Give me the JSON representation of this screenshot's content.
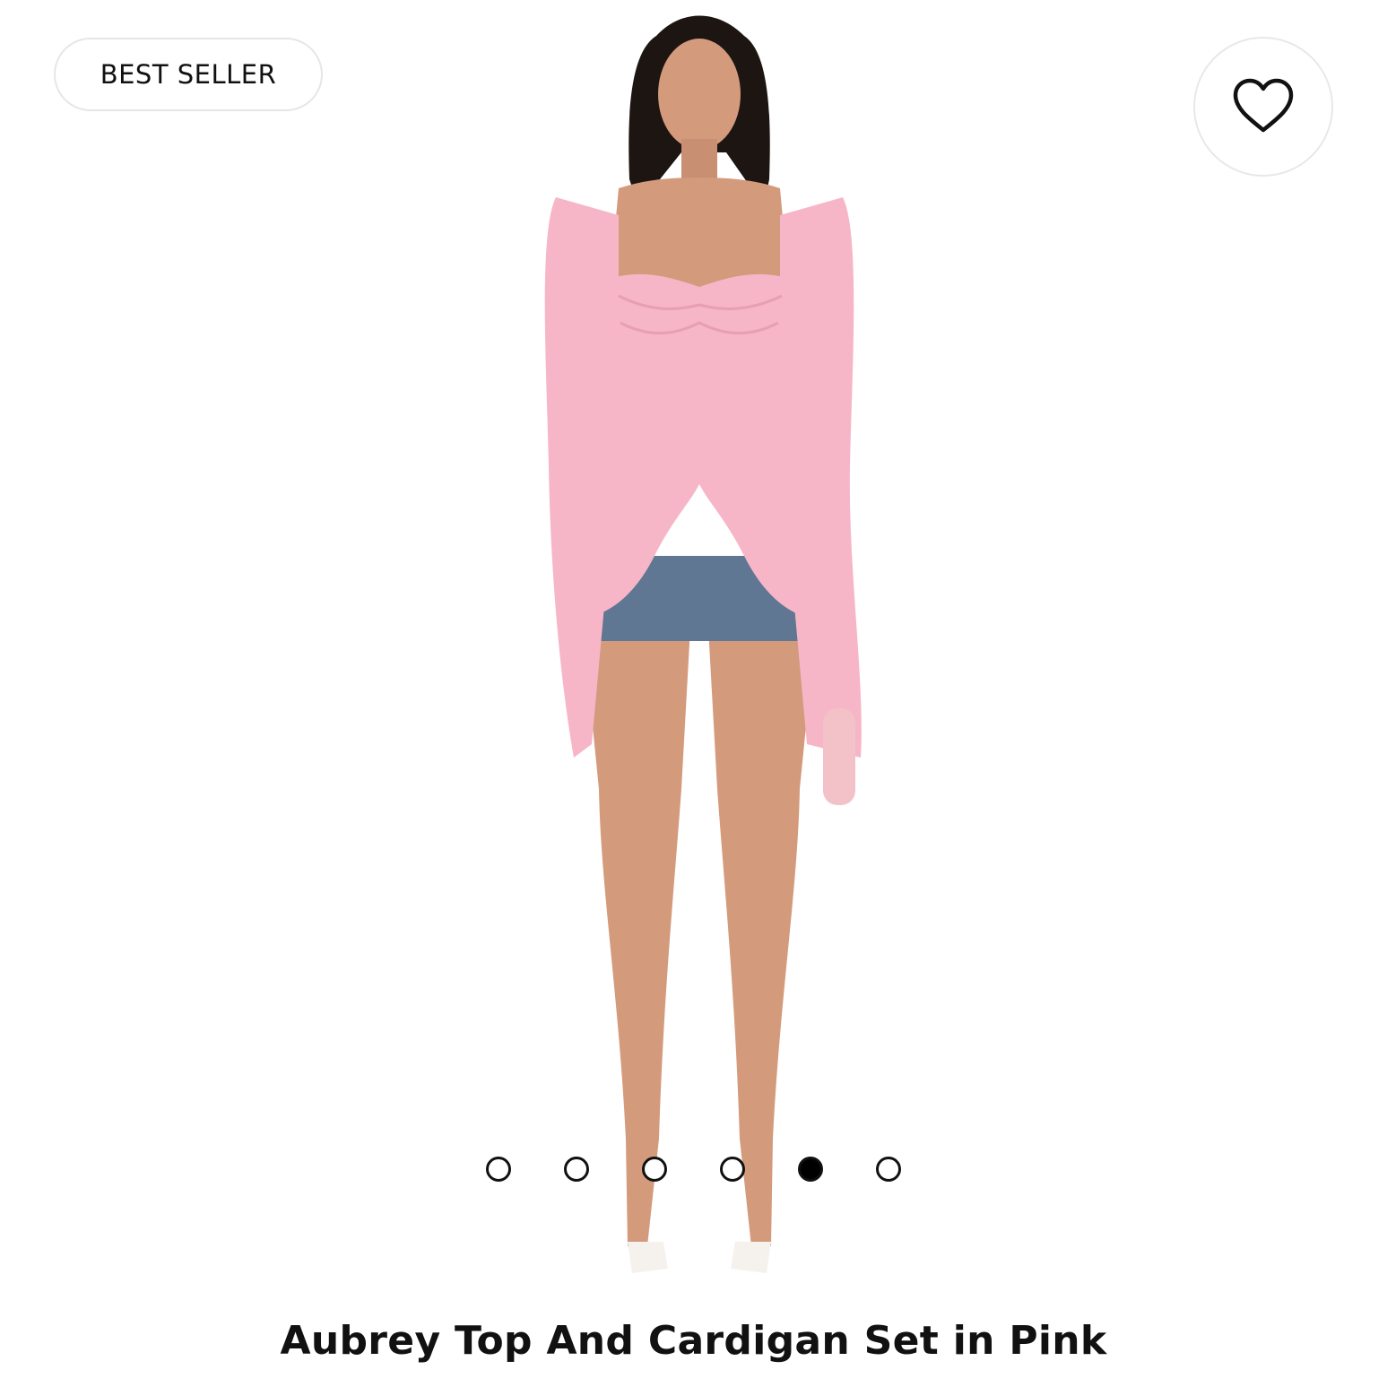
{
  "badge": {
    "label": "BEST SELLER"
  },
  "wishlist": {
    "icon": "heart-outline-icon"
  },
  "carousel": {
    "total": 6,
    "active_index": 4
  },
  "product": {
    "title": "Aubrey Top And Cardigan Set in Pink",
    "colors": {
      "garment": "#f6b6c8",
      "denim": "#5f7792",
      "skin": "#d49a7c",
      "hair": "#1c1512",
      "shoes": "#f5f2ee"
    }
  }
}
